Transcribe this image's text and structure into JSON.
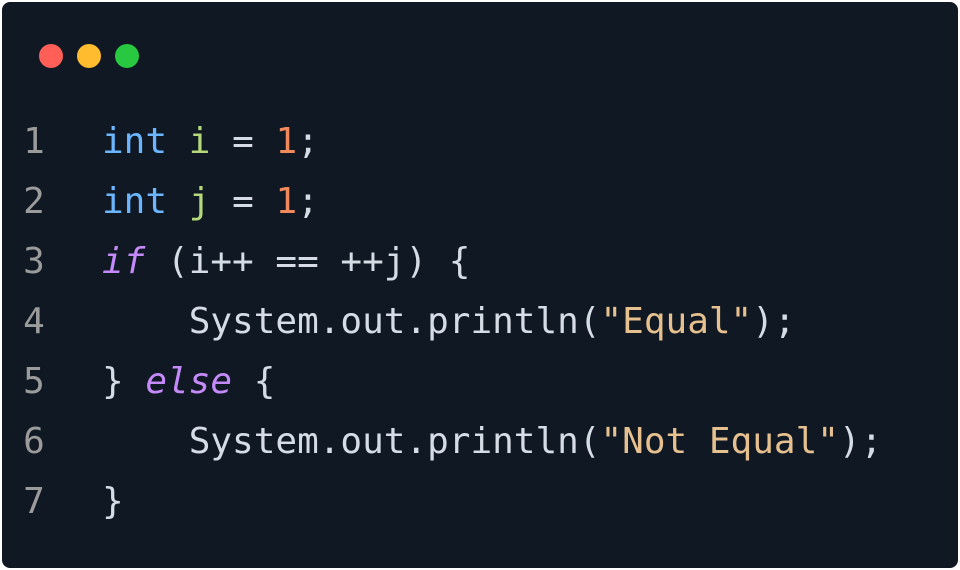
{
  "window": {
    "dots": [
      {
        "name": "close-dot",
        "color": "#ff5f57"
      },
      {
        "name": "minimize-dot",
        "color": "#febc2e"
      },
      {
        "name": "maximize-dot",
        "color": "#28c840"
      }
    ]
  },
  "code": {
    "lines": [
      {
        "number": "1",
        "tokens": [
          {
            "text": "int",
            "cls": "kw-type"
          },
          {
            "text": " ",
            "cls": "plain"
          },
          {
            "text": "i",
            "cls": "var"
          },
          {
            "text": " = ",
            "cls": "plain"
          },
          {
            "text": "1",
            "cls": "num"
          },
          {
            "text": ";",
            "cls": "plain"
          }
        ]
      },
      {
        "number": "2",
        "tokens": [
          {
            "text": "int",
            "cls": "kw-type"
          },
          {
            "text": " ",
            "cls": "plain"
          },
          {
            "text": "j",
            "cls": "var"
          },
          {
            "text": " = ",
            "cls": "plain"
          },
          {
            "text": "1",
            "cls": "num"
          },
          {
            "text": ";",
            "cls": "plain"
          }
        ]
      },
      {
        "number": "3",
        "tokens": [
          {
            "text": "if",
            "cls": "ctl"
          },
          {
            "text": " (i++ == ++j) {",
            "cls": "plain"
          }
        ]
      },
      {
        "number": "4",
        "tokens": [
          {
            "text": "    System.out.println(",
            "cls": "plain"
          },
          {
            "text": "\"Equal\"",
            "cls": "str"
          },
          {
            "text": ");",
            "cls": "plain"
          }
        ]
      },
      {
        "number": "5",
        "tokens": [
          {
            "text": "} ",
            "cls": "plain"
          },
          {
            "text": "else",
            "cls": "ctl"
          },
          {
            "text": " {",
            "cls": "plain"
          }
        ]
      },
      {
        "number": "6",
        "tokens": [
          {
            "text": "    System.out.println(",
            "cls": "plain"
          },
          {
            "text": "\"Not Equal\"",
            "cls": "str"
          },
          {
            "text": ");",
            "cls": "plain"
          }
        ]
      },
      {
        "number": "7",
        "tokens": [
          {
            "text": "}",
            "cls": "plain"
          }
        ]
      }
    ]
  }
}
